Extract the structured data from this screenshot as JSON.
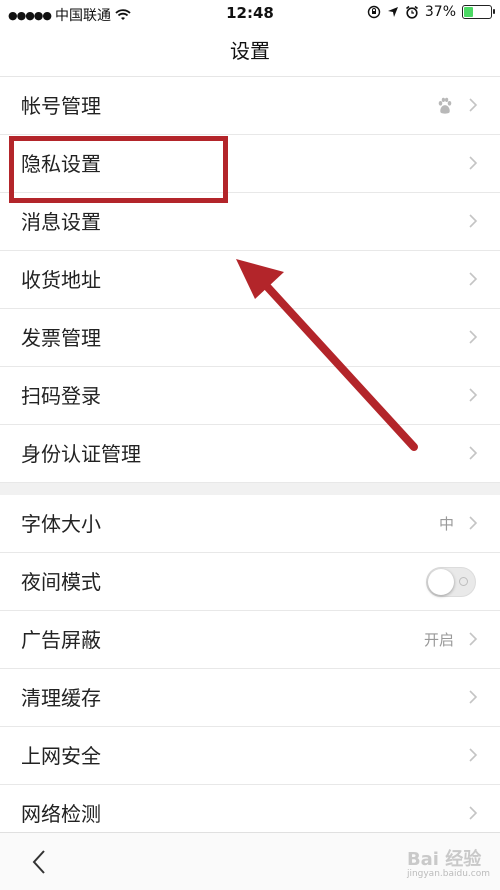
{
  "status_bar": {
    "carrier": "中国联通",
    "time": "12:48",
    "battery": "37%",
    "battery_level": 0.37,
    "battery_color": "#4cd964"
  },
  "nav": {
    "title": "设置"
  },
  "group1": [
    {
      "label": "帐号管理",
      "accessory": "baidu-paw-icon"
    },
    {
      "label": "隐私设置"
    },
    {
      "label": "消息设置"
    },
    {
      "label": "收货地址"
    },
    {
      "label": "发票管理"
    },
    {
      "label": "扫码登录"
    },
    {
      "label": "身份认证管理"
    }
  ],
  "group2": [
    {
      "label": "字体大小",
      "value": "中"
    },
    {
      "label": "夜间模式",
      "toggle_on": false
    },
    {
      "label": "广告屏蔽",
      "value": "开启"
    },
    {
      "label": "清理缓存"
    },
    {
      "label": "上网安全"
    },
    {
      "label": "网络检测"
    }
  ],
  "annotation": {
    "color": "#b3252a",
    "highlighted": "隐私设置"
  },
  "watermark": {
    "text": "Bai 经验",
    "sub": "jingyan.baidu.com"
  }
}
